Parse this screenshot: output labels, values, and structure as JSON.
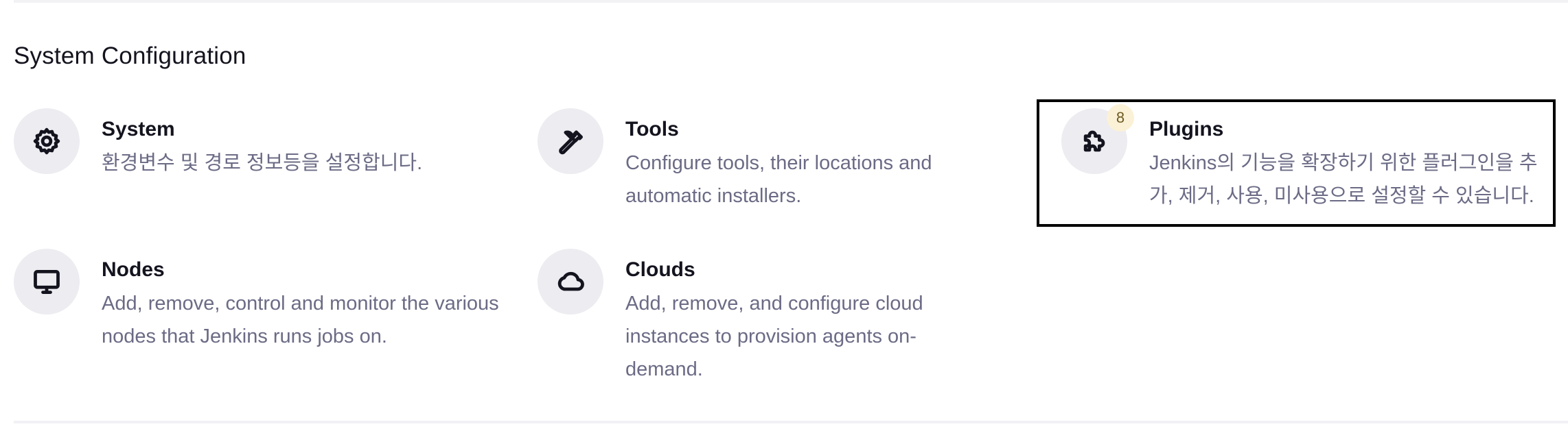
{
  "section": {
    "title": "System Configuration"
  },
  "items": [
    {
      "title": "System",
      "description": "환경변수 및 경로 정보등을 설정합니다.",
      "icon": "gear-icon"
    },
    {
      "title": "Tools",
      "description": "Configure tools, their locations and automatic installers.",
      "icon": "hammer-icon"
    },
    {
      "title": "Plugins",
      "description": "Jenkins의 기능을 확장하기 위한 플러그인을 추가, 제거, 사용, 미사용으로 설정할 수 있습니다.",
      "icon": "puzzle-icon",
      "badge": "8"
    },
    {
      "title": "Nodes",
      "description": "Add, remove, control and monitor the various nodes that Jenkins runs jobs on.",
      "icon": "monitor-icon"
    },
    {
      "title": "Clouds",
      "description": "Add, remove, and configure cloud instances to provision agents on-demand.",
      "icon": "cloud-icon"
    }
  ],
  "colors": {
    "text": "#14141f",
    "muted": "#6b6b86",
    "icon_bg": "#ececf1",
    "badge_bg": "#fbf1d6",
    "focus_border": "#000000"
  }
}
